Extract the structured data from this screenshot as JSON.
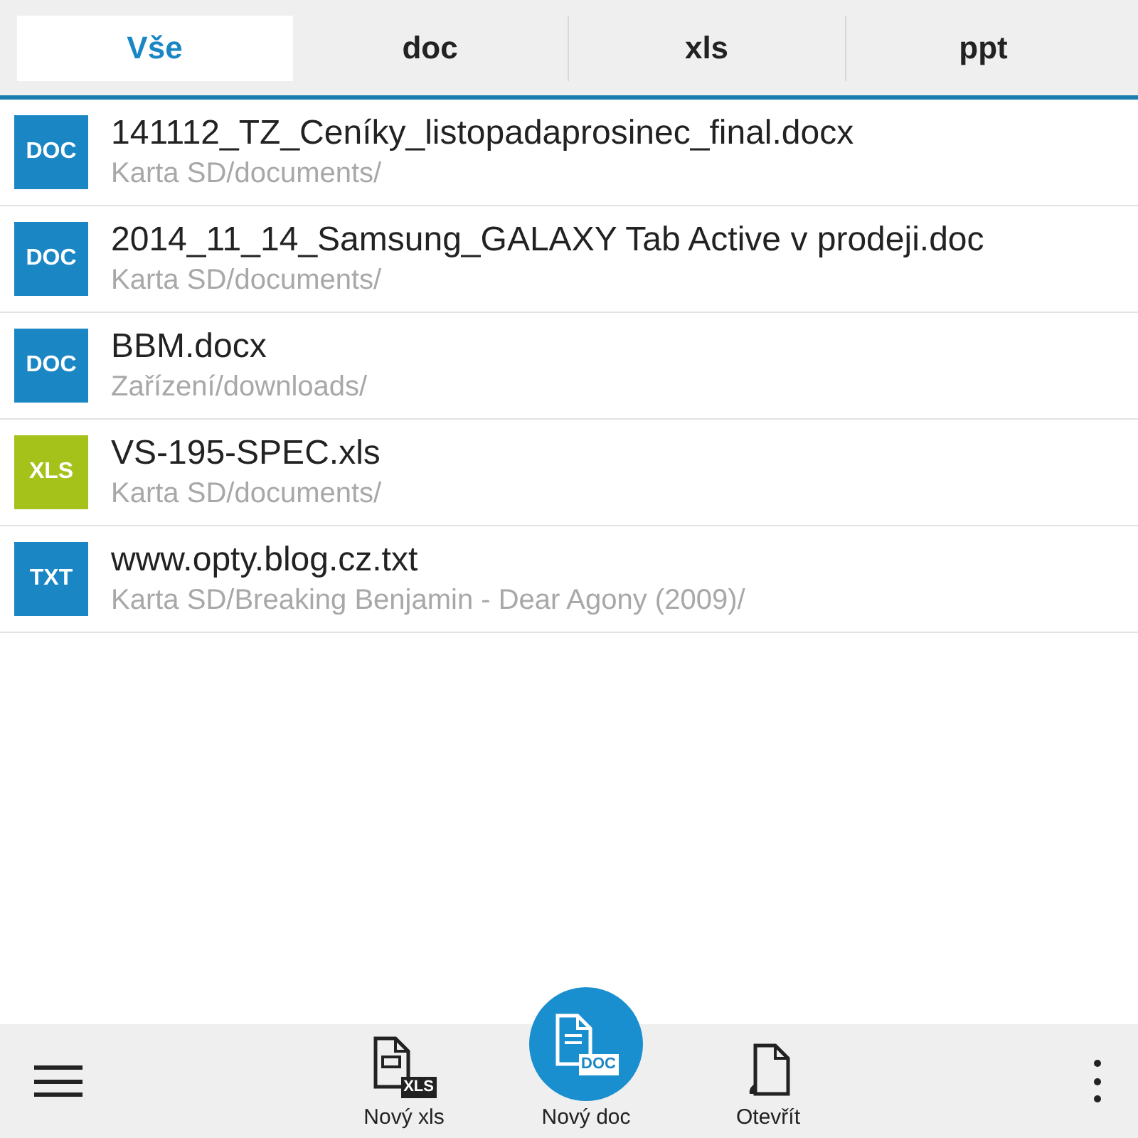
{
  "tabs": [
    {
      "label": "Vše",
      "selected": true
    },
    {
      "label": "doc",
      "selected": false
    },
    {
      "label": "xls",
      "selected": false
    },
    {
      "label": "ppt",
      "selected": false
    }
  ],
  "files": [
    {
      "badge": "DOC",
      "color": "#1a86c4",
      "name": "141112_TZ_Ceníky_listopadaprosinec_final.docx",
      "path": "Karta SD/documents/"
    },
    {
      "badge": "DOC",
      "color": "#1a86c4",
      "name": "2014_11_14_Samsung_GALAXY Tab Active v prodeji.doc",
      "path": "Karta SD/documents/"
    },
    {
      "badge": "DOC",
      "color": "#1a86c4",
      "name": "BBM.docx",
      "path": "Zařízení/downloads/"
    },
    {
      "badge": "XLS",
      "color": "#a5c21b",
      "name": "VS-195-SPEC.xls",
      "path": "Karta SD/documents/"
    },
    {
      "badge": "TXT",
      "color": "#1a86c4",
      "name": "www.opty.blog.cz.txt",
      "path": "Karta SD/Breaking Benjamin - Dear Agony (2009)/"
    }
  ],
  "actions": [
    {
      "kind": "new-xls",
      "label": "Nový xls",
      "badge": "XLS"
    },
    {
      "kind": "new-doc",
      "label": "Nový doc",
      "badge": "DOC"
    },
    {
      "kind": "open",
      "label": "Otevřít"
    }
  ]
}
